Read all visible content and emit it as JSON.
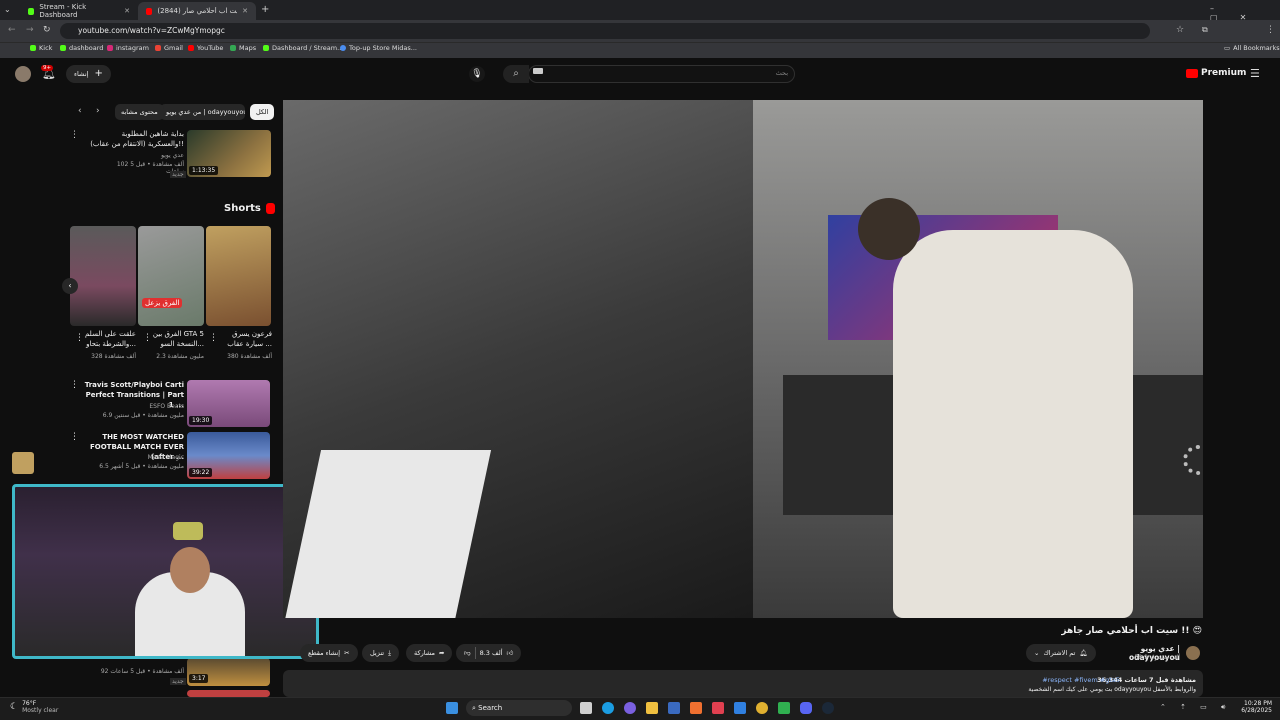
{
  "tabs": [
    {
      "label": "Stream - Kick Dashboard",
      "active": false
    },
    {
      "label": "(2844) سيت اب أحلامي صار",
      "active": true
    }
  ],
  "address": "youtube.com/watch?v=ZCwMgYmopgc",
  "bookmarks": [
    "Kick",
    "dashboard",
    "instagram",
    "Gmail",
    "YouTube",
    "Maps",
    "Dashboard / Stream...",
    "Top-up Store Midas..."
  ],
  "all_bookmarks": "All Bookmarks",
  "yt": {
    "logo": "Premium",
    "search_placeholder": "بحث",
    "create_label": "إنشاء",
    "notif_count": "9+"
  },
  "chips": [
    "الكل",
    "من عدي يويو | odayyouyou",
    "محتوى مشابه"
  ],
  "top_video": {
    "title": "بداية شاهين المطلوبة والعسكرية (الانتقام من عقاب)!!",
    "channel": "عدي يويو",
    "meta": "102 ألف مشاهدة • قبل 5 ساعات",
    "badge": "جديد",
    "duration": "1:13:35"
  },
  "shorts_title": "Shorts",
  "shorts": [
    {
      "title": "فرعون يسرق سيارة عقاب ...",
      "views": "380 ألف مشاهدة"
    },
    {
      "title": "الفرق بين GTA 5 النسخة السو...",
      "views": "2.3 مليون مشاهدة"
    },
    {
      "title": "علقت على السلم والشرطة بتحاو...",
      "views": "328 ألف مشاهدة"
    }
  ],
  "short_overlay": "الفرق يزعل",
  "list_videos": [
    {
      "title": "Travis Scott/Playboi Carti Perfect Transitions | Part 1 ...",
      "channel": "ESFO Beats",
      "meta": "6.9 مليون مشاهدة • قبل سنتين",
      "duration": "19:30"
    },
    {
      "title": "THE MOST WATCHED FOOTBALL MATCH EVER (after ...",
      "channel": "Messi Magic",
      "meta": "6.5 مليون مشاهدة • قبل 5 أشهر",
      "duration": "39:22"
    }
  ],
  "bottom_video": {
    "meta": "92 ألف مشاهدة • قبل 5 ساعات",
    "badge": "جديد",
    "duration": "3:17"
  },
  "video_title": "سيت اب أحلامي صار جاهز !! 😍",
  "channel": {
    "name": "عدي يويو | odayyouyou",
    "subs": "58.9 ألف مشترك"
  },
  "actions": {
    "subscribed": "تم الاشتراك",
    "likes": "8.3 ألف",
    "share": "مشاركة",
    "download": "تنزيل",
    "clip": "إنشاء مقطع"
  },
  "description": {
    "stats": "36,344 مشاهدة قبل 7 ساعات",
    "tags": "#respect #fivem #gta5",
    "line1": "بث يومي على كيك اسم الشخصية odayyouyou والروابط بالأسفل"
  },
  "weather": {
    "temp": "76°F",
    "cond": "Mostly clear"
  },
  "taskbar_search": "Search",
  "clock": {
    "time": "10:28 PM",
    "date": "6/28/2025"
  }
}
